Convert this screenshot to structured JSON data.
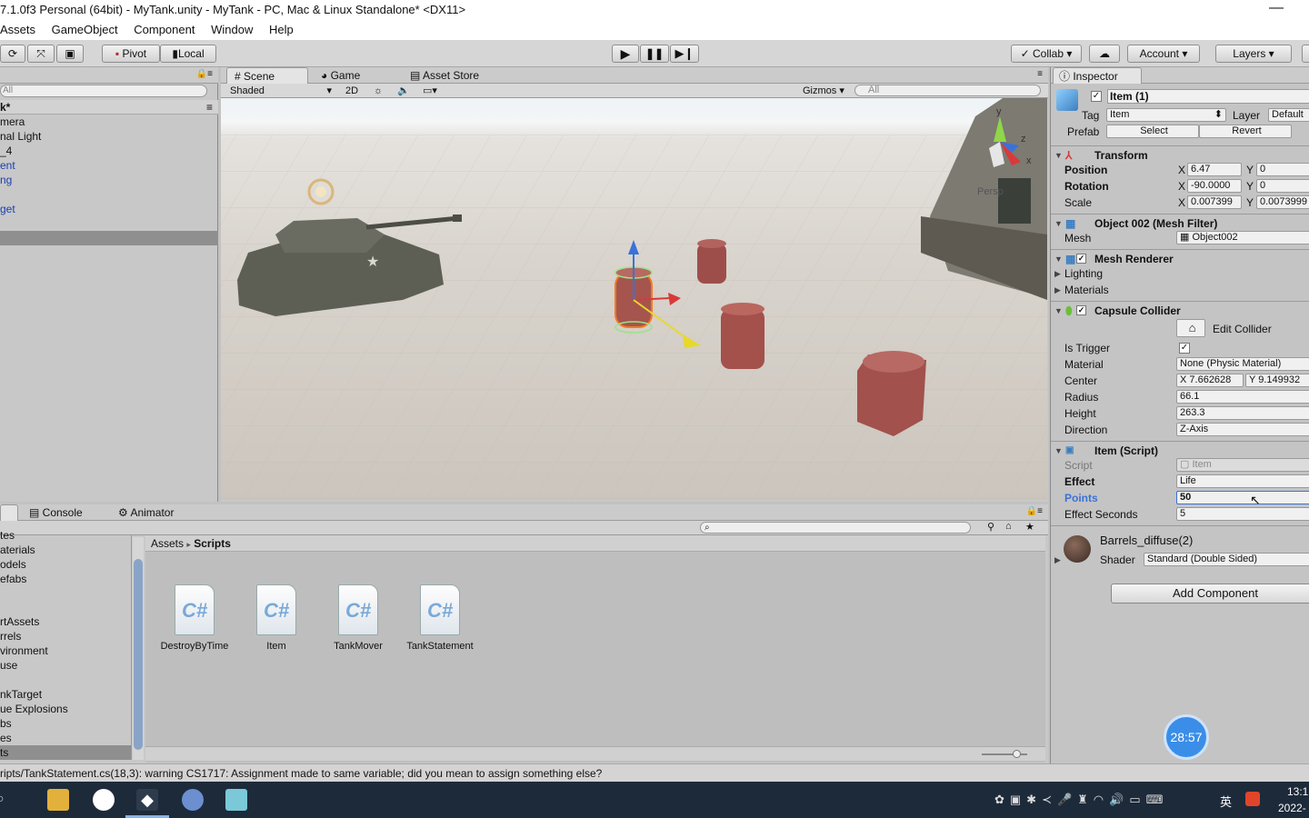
{
  "window": {
    "title": "7.1.0f3 Personal (64bit) - MyTank.unity - MyTank - PC, Mac & Linux Standalone* <DX11>",
    "minimize": "—"
  },
  "menu": [
    "Assets",
    "GameObject",
    "Component",
    "Window",
    "Help"
  ],
  "toolbar": {
    "pivot": "Pivot",
    "local": "Local",
    "collab": "Collab",
    "account": "Account",
    "layers": "Layers"
  },
  "hierarchy": {
    "search_placeholder": "All",
    "scene_name": "k*",
    "items": [
      "mera",
      "nal Light",
      "_4",
      "ent",
      "ng",
      "",
      "get",
      ""
    ]
  },
  "scene_tabs": {
    "scene": "Scene",
    "game": "Game",
    "asset_store": "Asset Store",
    "shading": "Shaded",
    "mode2d": "2D",
    "gizmos": "Gizmos",
    "search_placeholder": "All",
    "persp": "Persp",
    "axis_y": "y",
    "axis_z": "z",
    "axis_x": "x"
  },
  "bottom_tabs": {
    "console": "Console",
    "animator": "Animator"
  },
  "project": {
    "tree": [
      "tes",
      "aterials",
      "odels",
      "efabs",
      "",
      "rtAssets",
      "rrels",
      "vironment",
      "use",
      "",
      "nkTarget",
      "ue Explosions",
      "bs",
      "es",
      "ts"
    ],
    "breadcrumb_root": "Assets",
    "breadcrumb_leaf": "Scripts",
    "files": [
      "DestroyByTime",
      "Item",
      "TankMover",
      "TankStatement"
    ]
  },
  "inspector": {
    "tab": "Inspector",
    "object_name": "Item (1)",
    "tag_label": "Tag",
    "tag_value": "Item",
    "layer_label": "Layer",
    "layer_value": "Default",
    "prefab_label": "Prefab",
    "prefab_select": "Select",
    "prefab_revert": "Revert",
    "transform": {
      "title": "Transform",
      "position_label": "Position",
      "rotation_label": "Rotation",
      "scale_label": "Scale",
      "x": "X",
      "y": "Y",
      "pos_x": "6.47",
      "pos_y": "0",
      "rot_x": "-90.0000",
      "rot_y": "0",
      "scale_x": "0.007399",
      "scale_y": "0.0073999"
    },
    "mesh_filter": {
      "title": "Object 002 (Mesh Filter)",
      "mesh_label": "Mesh",
      "mesh_value": "Object002"
    },
    "mesh_renderer": {
      "title": "Mesh Renderer",
      "lighting": "Lighting",
      "materials": "Materials"
    },
    "capsule": {
      "title": "Capsule Collider",
      "edit": "Edit Collider",
      "is_trigger": "Is Trigger",
      "material_label": "Material",
      "material_value": "None (Physic Material)",
      "center_label": "Center",
      "center_x": "7.662628",
      "center_y": "9.149932",
      "radius_label": "Radius",
      "radius": "66.1",
      "height_label": "Height",
      "height": "263.3",
      "direction_label": "Direction",
      "direction": "Z-Axis"
    },
    "script": {
      "title": "Item (Script)",
      "script_label": "Script",
      "script_value": "Item",
      "effect_label": "Effect",
      "effect_value": "Life",
      "points_label": "Points",
      "points_value": "50",
      "seconds_label": "Effect Seconds",
      "seconds_value": "5"
    },
    "material": {
      "name": "Barrels_diffuse(2)",
      "shader_label": "Shader",
      "shader_value": "Standard (Double Sided)"
    },
    "add_component": "Add Component",
    "timer": "28:57"
  },
  "status": "ripts/TankStatement.cs(18,3): warning CS1717: Assignment made to same variable; did you mean to assign something else?",
  "taskbar": {
    "time": "13:1",
    "date": "2022-",
    "ime": "英"
  },
  "colors": {
    "selection_blue": "#3a72d8",
    "timer_blue": "#3a8ee8",
    "link_blue": "#1a3fb0"
  }
}
